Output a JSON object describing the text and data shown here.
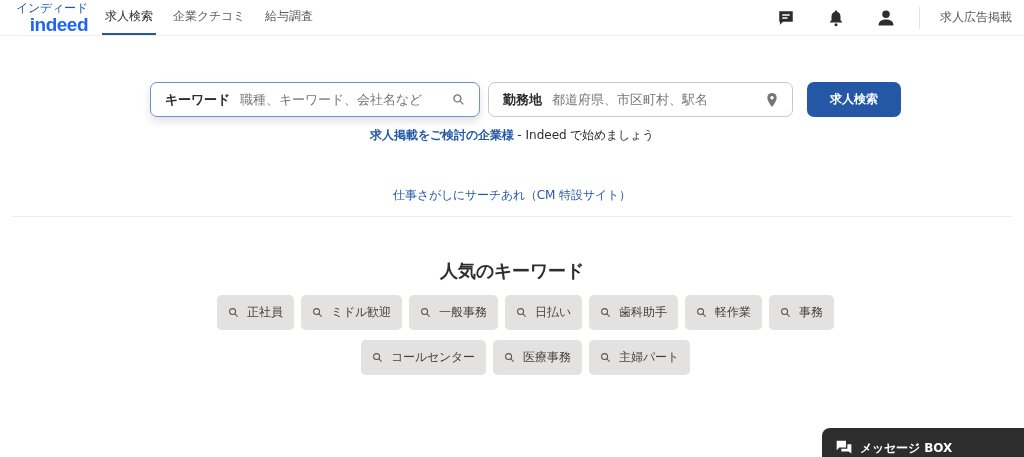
{
  "logo": {
    "text": "indeed",
    "ruby": "インディード"
  },
  "nav": [
    {
      "label": "求人検索",
      "selected": true
    },
    {
      "label": "企業クチコミ",
      "selected": false
    },
    {
      "label": "給与調査",
      "selected": false
    }
  ],
  "employer_link": "求人広告掲載",
  "search": {
    "keyword_label": "キーワード",
    "keyword_placeholder": "職種、キーワード、会社名など",
    "location_label": "勤務地",
    "location_placeholder": "都道府県、市区町村、駅名",
    "button": "求人検索"
  },
  "employer_promo": {
    "link": "求人掲載をご検討の企業様",
    "text": " - Indeed で始めましょう"
  },
  "cm_link": "仕事さがしにサーチあれ（CM 特設サイト）",
  "popular": {
    "title": "人気のキーワード",
    "keywords": [
      "正社員",
      "ミドル歓迎",
      "一般事務",
      "日払い",
      "歯科助手",
      "軽作業",
      "事務",
      "コールセンター",
      "医療事務",
      "主婦パート"
    ]
  },
  "message_box": "メッセージ BOX"
}
